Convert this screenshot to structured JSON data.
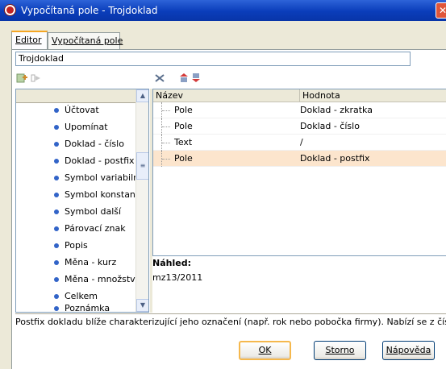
{
  "window": {
    "title": "Vypočítaná pole - Trojdoklad"
  },
  "tabs": [
    {
      "label": "Editor"
    },
    {
      "label": "Vypočítaná pole"
    }
  ],
  "name_field": {
    "value": "Trojdoklad"
  },
  "field_list": {
    "items": [
      {
        "label": "Účtovat"
      },
      {
        "label": "Upomínat"
      },
      {
        "label": "Doklad - číslo"
      },
      {
        "label": "Doklad - postfix"
      },
      {
        "label": "Symbol variabilní"
      },
      {
        "label": "Symbol konstantní"
      },
      {
        "label": "Symbol další"
      },
      {
        "label": "Párovací znak"
      },
      {
        "label": "Popis"
      },
      {
        "label": "Měna - kurz"
      },
      {
        "label": "Měna - množství"
      },
      {
        "label": "Celkem"
      },
      {
        "label": "Poznámka"
      }
    ]
  },
  "grid": {
    "columns": [
      "Název",
      "Hodnota"
    ],
    "rows": [
      {
        "name": "Pole",
        "value": "Doklad - zkratka"
      },
      {
        "name": "Pole",
        "value": "Doklad - číslo"
      },
      {
        "name": "Text",
        "value": "/"
      },
      {
        "name": "Pole",
        "value": "Doklad - postfix"
      }
    ]
  },
  "preview": {
    "label": "Náhled:",
    "value": "mz13/2011"
  },
  "status": {
    "text": "Postfix dokladu blíže charakterizující jeho označení (např. rok nebo pobočka firmy). Nabízí se z číselníku"
  },
  "buttons": {
    "ok": "OK",
    "cancel": "Storno",
    "help": "Nápověda"
  },
  "colors": {
    "title_bar": "#0a3dba",
    "selected_row": "#fce5cd",
    "list_bullet": "#3264c8",
    "default_button_border": "#f5b84d"
  }
}
